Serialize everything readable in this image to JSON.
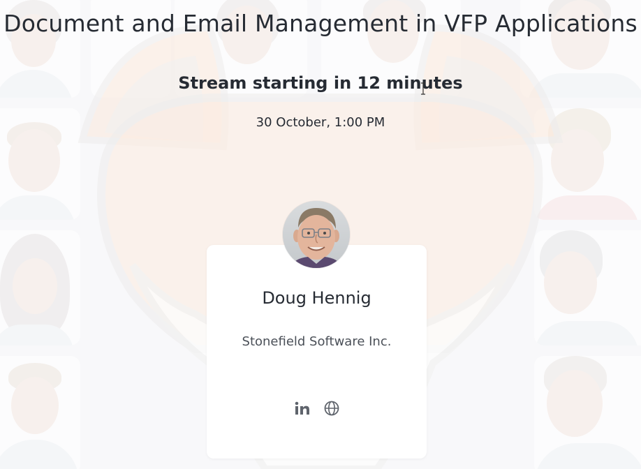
{
  "event": {
    "title": "Document and Email Management in VFP Applications",
    "countdown": "Stream starting in 12 minutes",
    "datetime": "30 October, 1:00 PM"
  },
  "speaker": {
    "name": "Doug Hennig",
    "company": "Stonefield Software Inc.",
    "links": [
      {
        "icon": "linkedin-icon"
      },
      {
        "icon": "globe-icon"
      }
    ]
  },
  "colors": {
    "text": "#262b33",
    "muted": "#4b5058",
    "icon": "#5f646c",
    "card": "#ffffff",
    "mascot_orange": "#f7c8a8"
  }
}
